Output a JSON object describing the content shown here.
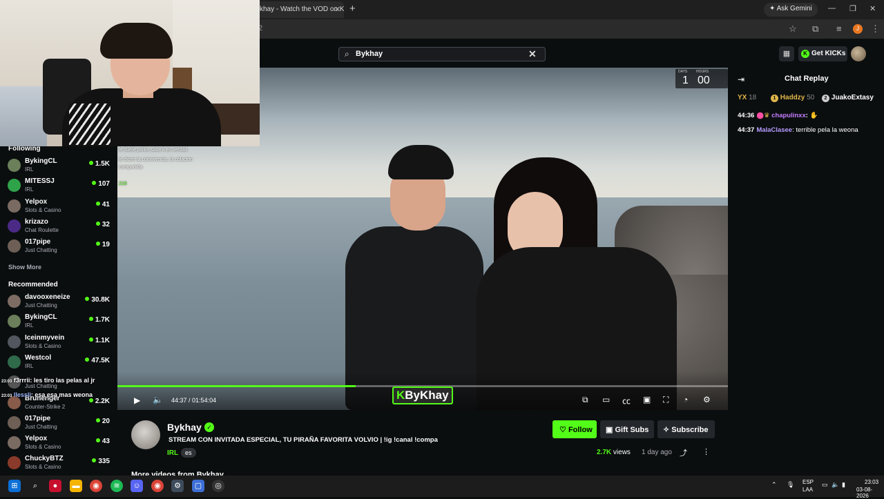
{
  "browser": {
    "tab_title": "khay - Watch the VOD on Ki",
    "url": "2",
    "ask_gemini": "Ask Gemini",
    "profile_initial": "J"
  },
  "header": {
    "search_value": "Bykhay",
    "get_kicks": "Get KICKs"
  },
  "sidebar": {
    "following_title": "Following",
    "following": [
      {
        "name": "BykingCL",
        "category": "IRL",
        "viewers": "1.5K",
        "color": "#6b7f5a"
      },
      {
        "name": "MITESSJ",
        "category": "IRL",
        "viewers": "107",
        "color": "#2fa34a"
      },
      {
        "name": "Yelpox",
        "category": "Slots & Casino",
        "viewers": "41",
        "color": "#7a6b62"
      },
      {
        "name": "krizazo",
        "category": "Chat Roulette",
        "viewers": "32",
        "color": "#4b2a86"
      },
      {
        "name": "017pipe",
        "category": "Just Chatting",
        "viewers": "19",
        "color": "#6d5f55"
      }
    ],
    "show_more": "Show More",
    "recommended_title": "Recommended",
    "recommended": [
      {
        "name": "davooxeneize",
        "category": "Just Chatting",
        "viewers": "30.8K",
        "color": "#7c6c63"
      },
      {
        "name": "BykingCL",
        "category": "IRL",
        "viewers": "1.7K",
        "color": "#6b7f5a"
      },
      {
        "name": "Iceinmyvein",
        "category": "Slots & Casino",
        "viewers": "1.1K",
        "color": "#52565e"
      },
      {
        "name": "Westcol",
        "category": "IRL",
        "viewers": "47.5K",
        "color": "#2f6a4b"
      },
      {
        "name": "",
        "category": "Just Chatting",
        "viewers": "",
        "color": "#555"
      },
      {
        "name": "Brunenger",
        "category": "Counter-Strike 2",
        "viewers": "2.2K",
        "color": "#885b4a"
      },
      {
        "name": "017pipe",
        "category": "Just Chatting",
        "viewers": "20",
        "color": "#6d5f55"
      },
      {
        "name": "Yelpox",
        "category": "Slots & Casino",
        "viewers": "43",
        "color": "#7a6b62"
      },
      {
        "name": "ChuckyBTZ",
        "category": "Slots & Casino",
        "viewers": "335",
        "color": "#8a3a2a"
      }
    ],
    "overlay_chat": [
      {
        "ts": "23:03",
        "user": "f3rrrii",
        "text": ": les tiro las pelas al jr"
      },
      {
        "ts": "23:03",
        "user": "llessli",
        "text": ": esa esa mas weona"
      }
    ]
  },
  "video": {
    "countdown_days_label": "DAYS",
    "countdown_hours_label": "HOURS",
    "countdown_days": "1",
    "countdown_hours": "00",
    "overlay_chat": [
      "le duele porke sabe k es verdad",
      "le dicen la convivencia, la colacion",
      "compartida",
      "215"
    ],
    "current_time": "44:37",
    "duration": "01:54:04",
    "progress": 0.39,
    "watermark_k": "K",
    "watermark_text": "ByKhay"
  },
  "chat": {
    "title": "Chat Replay",
    "top_gifters": [
      {
        "name": "YX",
        "count": "18",
        "color": "#e0b64a"
      },
      {
        "name": "Haddzy",
        "count": "50",
        "color": "#e0b64a"
      },
      {
        "name": "JuakoExtasy",
        "count": "",
        "color": "#ffffff"
      }
    ],
    "messages": [
      {
        "ts": "44:36",
        "user": "chapulinxx",
        "text": "",
        "color": "#c37cff"
      },
      {
        "ts": "44:37",
        "user": "MalaClasee",
        "text": ": terrible pela la weona",
        "color": "#b69cff"
      }
    ]
  },
  "stream": {
    "channel": "Bykhay",
    "title": "STREAM CON INVITADA ESPECIAL, TU PIRAÑA FAVORITA VOLVIO  | !ig !canal !compa",
    "category": "IRL",
    "language": "es",
    "follow": "Follow",
    "gift_subs": "Gift Subs",
    "subscribe": "Subscribe",
    "views": "2.7K",
    "views_label": "views",
    "ago": "1 day ago",
    "more_videos": "More videos from Bykhay"
  },
  "taskbar": {
    "lang_1": "ESP",
    "lang_2": "LAA",
    "time": "23:03",
    "date": "03-08-2026"
  }
}
